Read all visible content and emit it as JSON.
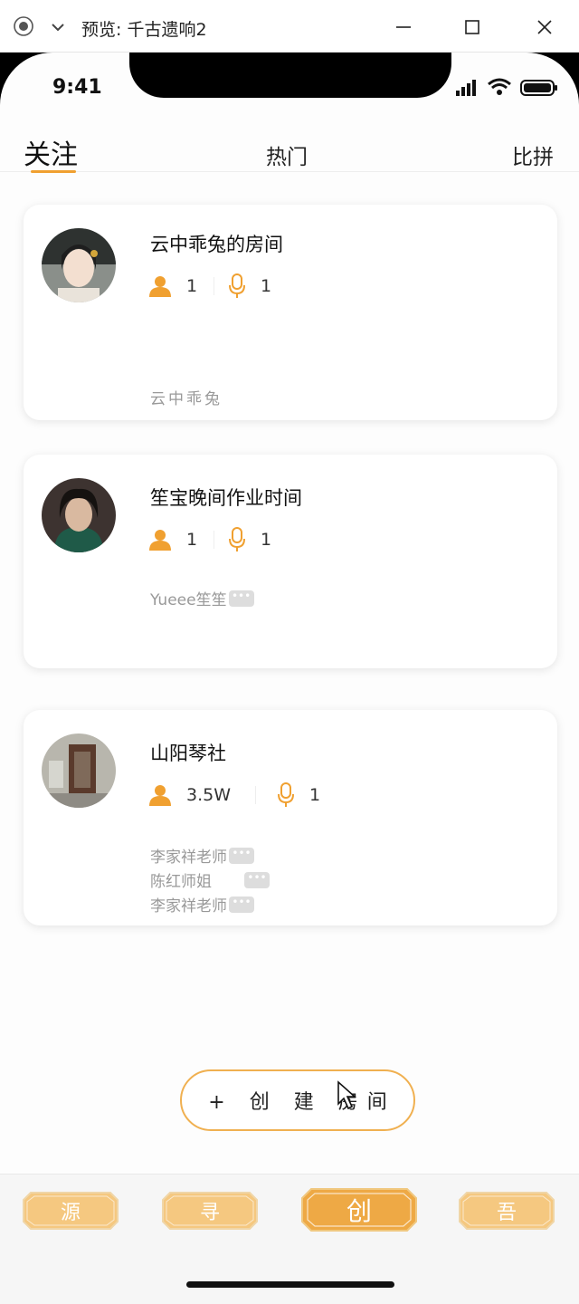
{
  "window": {
    "title": "预览: 千古遗响2",
    "icons": [
      "record-icon",
      "chevron-down-icon",
      "minimize-icon",
      "maximize-icon",
      "close-icon"
    ]
  },
  "status_bar": {
    "time": "9:41",
    "icons": [
      "signal-icon",
      "wifi-icon",
      "battery-icon"
    ]
  },
  "tabs": [
    {
      "label": "关注",
      "active": true
    },
    {
      "label": "热门",
      "active": false
    },
    {
      "label": "比拼",
      "active": false
    }
  ],
  "rooms": [
    {
      "title": "云中乖兔的房间",
      "listeners": "1",
      "speakers": "1",
      "members": [
        "云中乖兔"
      ]
    },
    {
      "title": "笙宝晚间作业时间",
      "listeners": "1",
      "speakers": "1",
      "members": [
        "Yueee笙笙"
      ]
    },
    {
      "title": "山阳琴社",
      "listeners": "3.5W",
      "speakers": "1",
      "members": [
        "李家祥老师",
        "陈红师姐",
        "李家祥老师"
      ]
    }
  ],
  "create_room_label": "+ 创 建 房间",
  "bottom_nav": [
    {
      "label": "源",
      "active": false
    },
    {
      "label": "寻",
      "active": false
    },
    {
      "label": "创",
      "active": true
    },
    {
      "label": "吾",
      "active": false
    }
  ],
  "colors": {
    "accent": "#f0a030",
    "nav_plate": "#f5c880",
    "nav_plate_active": "#eea945",
    "text_muted": "#999999"
  }
}
